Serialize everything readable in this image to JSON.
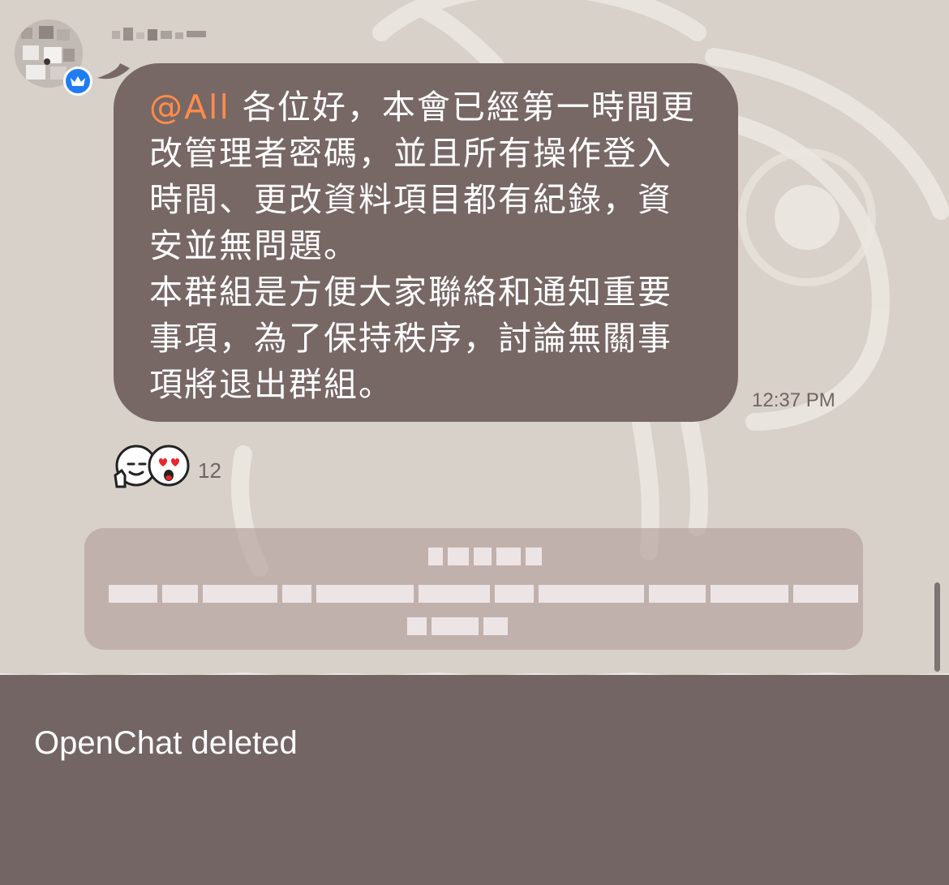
{
  "chat": {
    "sender_name": "",
    "message": {
      "mention": "@All",
      "text": " 各位好，本會已經第一時間更改管理者密碼，並且所有操作登入時間、更改資料項目都有紀錄，資安並無問題。\n本群組是方便大家聯絡和通知重要事項，為了保持秩序，討論無關事項將退出群組。",
      "time": "12:37 PM"
    },
    "reactions": {
      "icons": [
        "thumbs-up-sticker-icon",
        "heart-eyes-sticker-icon"
      ],
      "count": "12"
    },
    "system_message": {
      "text": ""
    }
  },
  "footer": {
    "status": "OpenChat deleted"
  },
  "colors": {
    "bubble": "#776765",
    "mention": "#ff8c4a",
    "background": "#d8d1c9",
    "footer": "#746565",
    "badge": "#1f7cf4"
  }
}
